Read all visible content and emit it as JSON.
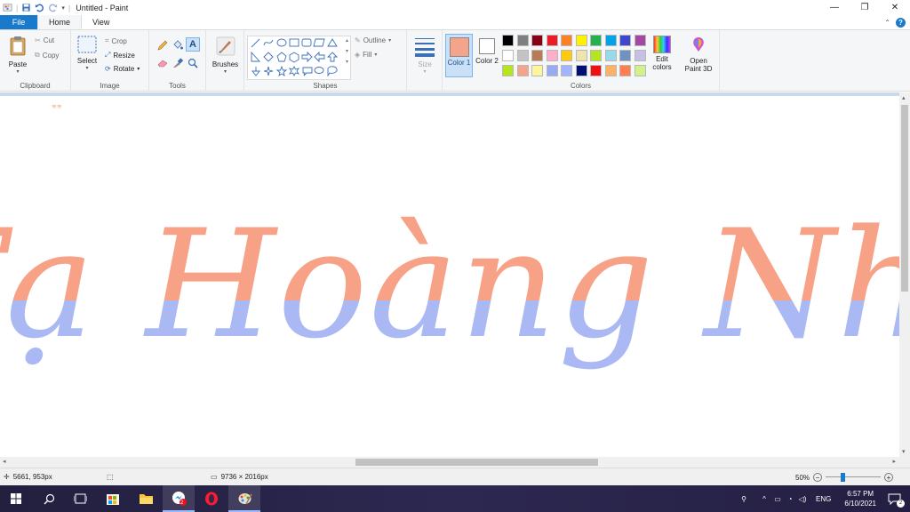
{
  "window": {
    "title": "Untitled - Paint"
  },
  "tabs": [
    {
      "label": "File"
    },
    {
      "label": "Home"
    },
    {
      "label": "View"
    }
  ],
  "ribbon": {
    "clipboard": {
      "label": "Clipboard",
      "paste": "Paste",
      "cut": "Cut",
      "copy": "Copy"
    },
    "image": {
      "label": "Image",
      "select": "Select",
      "crop": "Crop",
      "resize": "Resize",
      "rotate": "Rotate"
    },
    "tools": {
      "label": "Tools"
    },
    "brushes": {
      "label": "Brushes"
    },
    "shapes": {
      "label": "Shapes",
      "outline": "Outline",
      "fill": "Fill"
    },
    "size": {
      "label": "Size"
    },
    "colors": {
      "label": "Colors",
      "color1": "Color 1",
      "color2": "Color 2",
      "edit_colors": "Edit colors",
      "open_paint3d": "Open Paint 3D",
      "color1_value": "#f4a48a",
      "color2_value": "#ffffff",
      "palette_row1": [
        "#000000",
        "#7f7f7f",
        "#880015",
        "#ed1c24",
        "#ff7f27",
        "#fff200",
        "#22b14c",
        "#00a2e8",
        "#3f48cc",
        "#a349a4"
      ],
      "palette_row2": [
        "#ffffff",
        "#c3c3c3",
        "#b97a57",
        "#ffaec9",
        "#ffc90e",
        "#efe4b0",
        "#b5e61d",
        "#99d9ea",
        "#7092be",
        "#c8bfe7"
      ],
      "palette_row3": [
        "#b5e61d",
        "#f4a48a",
        "#fff59d",
        "#99aaf5",
        "#a0b4ff",
        "#000f75",
        "#ee1111",
        "#fdb26a",
        "#ff7f50",
        "#d2f08c"
      ]
    }
  },
  "canvas": {
    "artwork_text": "Tạ Hoàng Nhi",
    "color_top": "#f7a287",
    "color_bottom": "#aab8f3"
  },
  "status": {
    "cursor_pos": "5661, 953px",
    "image_size": "9736 × 2016px",
    "zoom": "50%",
    "zoom_fraction": 0.5
  },
  "taskbar": {
    "opera_badge": "2",
    "language": "ENG",
    "time": "6:57 PM",
    "date": "6/10/2021",
    "notification_count": "2"
  }
}
